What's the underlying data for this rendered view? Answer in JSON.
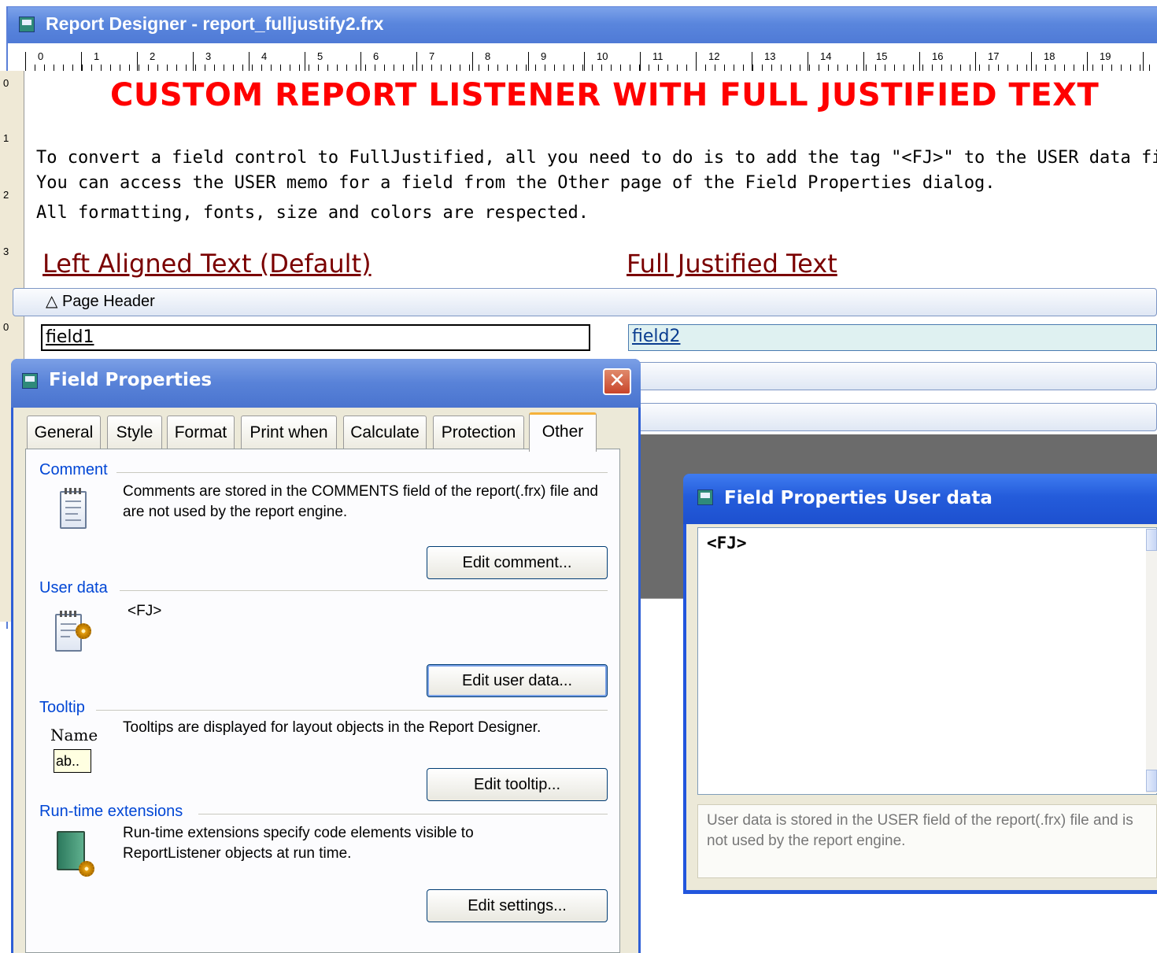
{
  "report_designer": {
    "title": "Report Designer - report_fulljustify2.frx",
    "ruler_h": [
      "0",
      "1",
      "2",
      "3",
      "4",
      "5",
      "6",
      "7",
      "8",
      "9",
      "10",
      "11",
      "12",
      "13",
      "14",
      "15",
      "16",
      "17",
      "18",
      "19"
    ],
    "ruler_v": [
      "0",
      "1",
      "2",
      "3"
    ],
    "ruler_v2": "0",
    "heading": "CUSTOM REPORT LISTENER WITH FULL JUSTIFIED TEXT",
    "desc_lines": [
      "To convert a field control to FullJustified, all you need to do is to add the tag \"<FJ>\" to the USER data field.",
      "You can access the USER memo for a field from the Other page of the Field Properties dialog.",
      "All formatting, fonts, size and colors are respected."
    ],
    "col_left": "Left Aligned Text (Default)",
    "col_right": "Full Justified Text",
    "band_label": "Page Header",
    "field1": "field1",
    "field2": "field2"
  },
  "field_properties": {
    "title": "Field Properties",
    "close_glyph": "✕",
    "tabs": [
      "General",
      "Style",
      "Format",
      "Print when",
      "Calculate",
      "Protection",
      "Other"
    ],
    "active_tab": "Other",
    "comment": {
      "label": "Comment",
      "text": "Comments are stored in the COMMENTS field of the report(.frx) file and are not used by the report engine.",
      "button": "Edit comment..."
    },
    "user_data": {
      "label": "User data",
      "value": "<FJ>",
      "button": "Edit user data..."
    },
    "tooltip": {
      "label": "Tooltip",
      "text": "Tooltips are displayed for layout objects in the Report Designer.",
      "icon_name": "Name",
      "icon_box": "ab..",
      "button": "Edit tooltip..."
    },
    "runtime": {
      "label": "Run-time extensions",
      "text": "Run-time extensions specify code elements visible to ReportListener objects at run time.",
      "button": "Edit settings..."
    }
  },
  "user_data_dialog": {
    "title": "Field Properties User data",
    "value": "<FJ>",
    "note": "User data is stored in the USER field of the report(.frx) file and is not used by the report engine."
  },
  "colors": {
    "heading": "#ff0000",
    "column_heading": "#7a0000",
    "title_bar": "#4f7ad6",
    "section_label": "#0046d5"
  }
}
